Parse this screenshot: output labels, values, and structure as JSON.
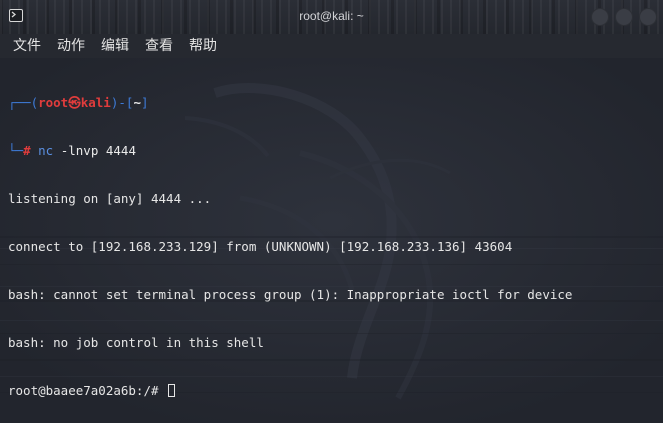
{
  "window": {
    "title": "root@kali: ~",
    "icon": "terminal-icon"
  },
  "menu": [
    "文件",
    "动作",
    "编辑",
    "查看",
    "帮助"
  ],
  "prompt": {
    "corner_top": "┌──",
    "open_paren": "(",
    "user": "root",
    "at_symbol": "㉿",
    "host": "kali",
    "close_paren": ")",
    "dash": "-",
    "dir_open": "[",
    "dir": "~",
    "dir_close": "]",
    "corner_bottom": "└─",
    "hash": "#",
    "command": "nc",
    "args": " -lnvp 4444"
  },
  "output": [
    "listening on [any] 4444 ...",
    "connect to [192.168.233.129] from (UNKNOWN) [192.168.233.136] 43604",
    "bash: cannot set terminal process group (1): Inappropriate ioctl for device",
    "bash: no job control in this shell",
    "root@baaee7a02a6b:/# "
  ],
  "colors": {
    "prompt_frame": "#3e7bd8",
    "prompt_user": "#e03c3c",
    "command": "#5a8fe0",
    "text": "#e6e6e6",
    "background": "#252932"
  }
}
